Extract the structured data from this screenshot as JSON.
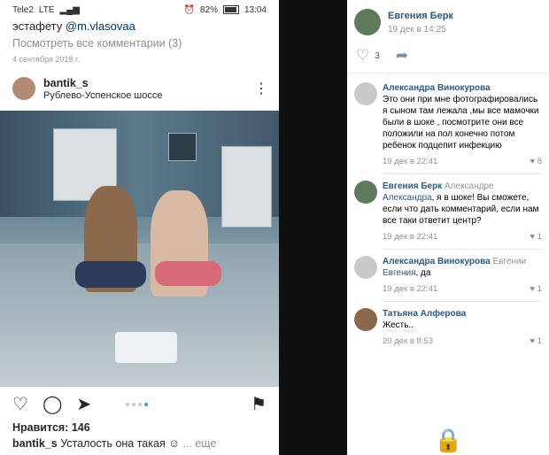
{
  "instagram": {
    "status_bar": {
      "carrier": "Tele2",
      "network": "LTE",
      "battery": "82%",
      "time": "13:04"
    },
    "caption_tail": {
      "text": "эстафету",
      "mention": "@m.vlasovaa"
    },
    "view_all_comments": "Посмотреть все комментарии (3)",
    "date": "4 сентября 2018 г.",
    "post": {
      "username": "bantik_s",
      "location": "Рублево-Успенское шоссе"
    },
    "likes": "Нравится: 146",
    "caption": {
      "username": "bantik_s",
      "text": "Усталость она такая",
      "more": "... еще"
    },
    "icons": [
      "heart-icon",
      "comment-icon",
      "send-icon",
      "bookmark-icon",
      "more-icon"
    ],
    "carousel": {
      "slides": 4,
      "active": 4
    }
  },
  "vk": {
    "author": {
      "name": "Евгения Берк",
      "date": "19 дек в 14:25"
    },
    "likes": "3",
    "comments": [
      {
        "author": "Александра Винокурова",
        "reply_to": "",
        "addressee": "",
        "text": "Это они при мне фотографировались я сыном там лежала ,мы все мамочки были в шоке , посмотрите они все положили на пол конечно потом ребенок подцепит инфекцию",
        "date": "19 дек в 22:41",
        "likes": "8"
      },
      {
        "author": "Евгения Берк",
        "reply_to": "Александре",
        "addressee": "Александра",
        "text": ", я в шоке! Вы сможете, если что дать комментарий, если нам все таки ответит центр?",
        "date": "19 дек в 22:41",
        "likes": "1"
      },
      {
        "author": "Александра Винокурова",
        "reply_to": "Евгении",
        "addressee": "Евгения",
        "text": ", да",
        "date": "19 дек в 22:41",
        "likes": "1"
      },
      {
        "author": "Татьяна Алферова",
        "reply_to": "",
        "addressee": "",
        "text": "Жесть..",
        "date": "20 дек в 8:53",
        "likes": "1"
      }
    ],
    "colors": {
      "link": "#2a5885",
      "meta": "#939393",
      "icon": "#7c91a7"
    }
  }
}
